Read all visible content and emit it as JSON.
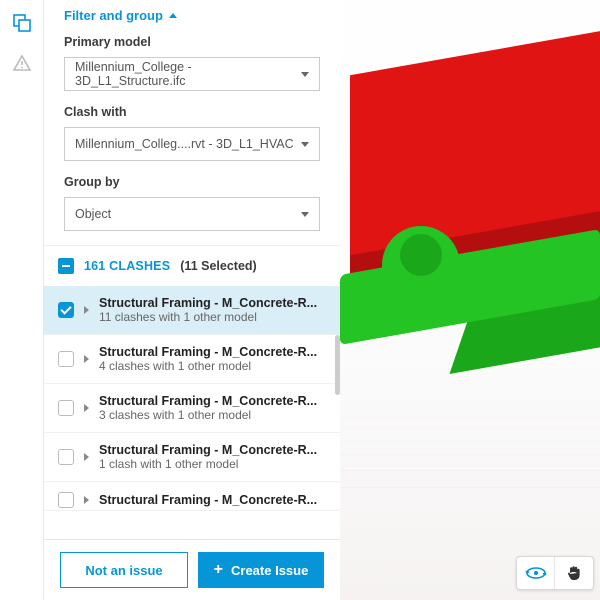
{
  "filter": {
    "label": "Filter and group"
  },
  "primary": {
    "label": "Primary model",
    "value": "Millennium_College - 3D_L1_Structure.ifc"
  },
  "clash": {
    "label": "Clash with",
    "value": "Millennium_Colleg....rvt - 3D_L1_HVAC"
  },
  "group": {
    "label": "Group by",
    "value": "Object"
  },
  "summary": {
    "count": "161 CLASHES",
    "selected": "(11 Selected)"
  },
  "rows": [
    {
      "title": "Structural Framing - M_Concrete-R...",
      "sub": "11 clashes with 1 other model",
      "checked": true
    },
    {
      "title": "Structural Framing - M_Concrete-R...",
      "sub": "4 clashes with 1 other model",
      "checked": false
    },
    {
      "title": "Structural Framing - M_Concrete-R...",
      "sub": "3 clashes with 1 other model",
      "checked": false
    },
    {
      "title": "Structural Framing - M_Concrete-R...",
      "sub": "1 clash with 1 other model",
      "checked": false
    },
    {
      "title": "Structural Framing - M_Concrete-R...",
      "sub": "",
      "checked": false
    }
  ],
  "footer": {
    "notIssue": "Not an issue",
    "create": "Create Issue"
  }
}
